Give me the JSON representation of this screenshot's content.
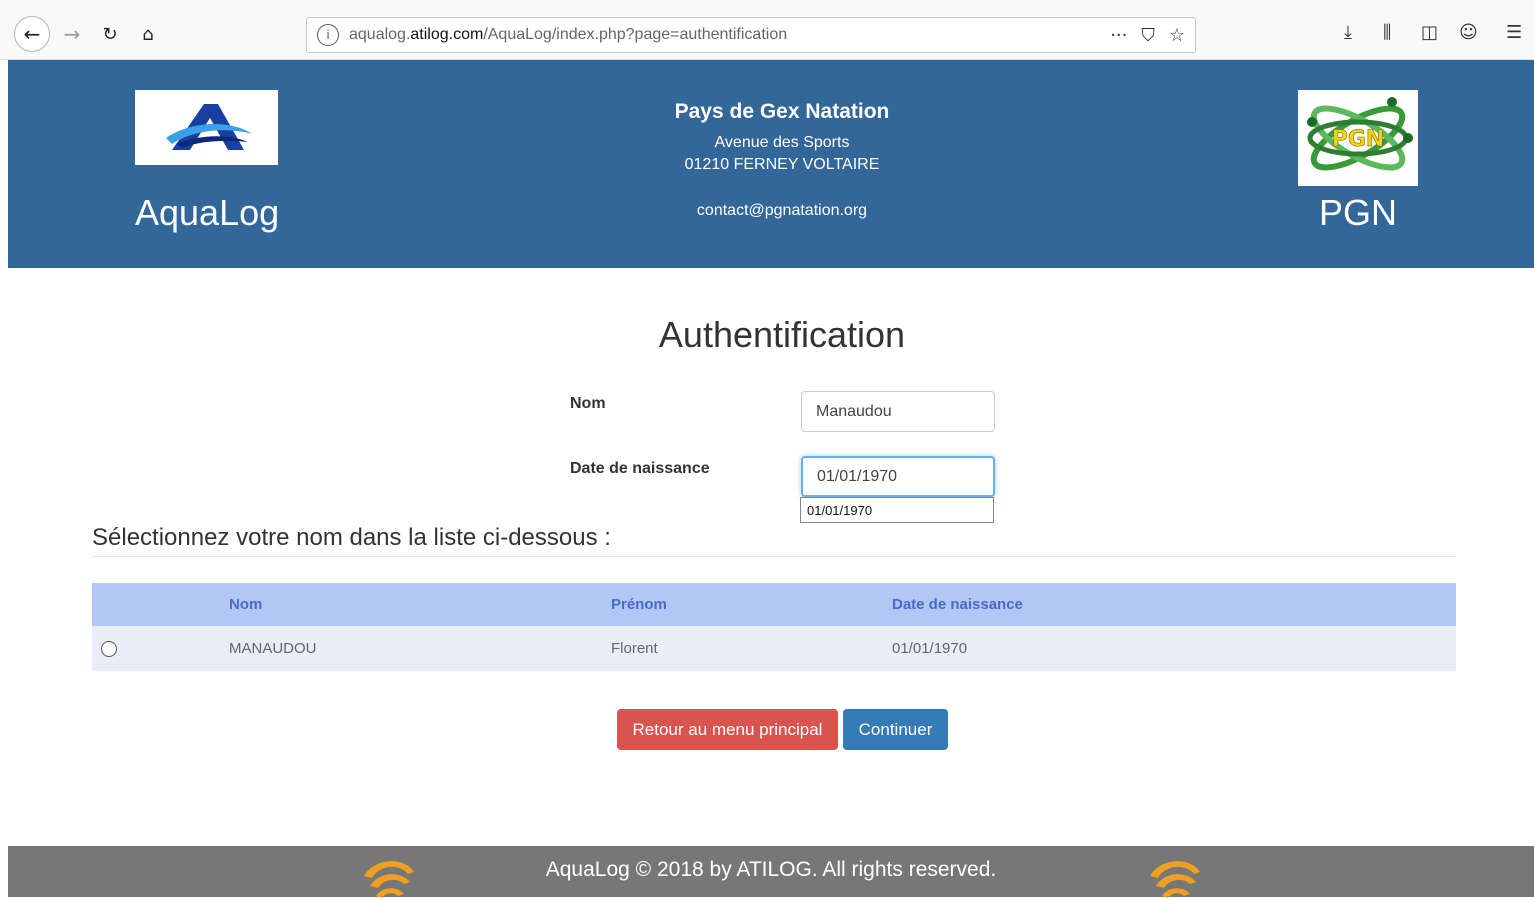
{
  "browser": {
    "url_host": "aqualog.atilog.com",
    "url_pre": "aqualog.",
    "url_domain": "atilog.com",
    "url_path": "/AquaLog/index.php?page=authentification",
    "icons": [
      "back-icon",
      "forward-icon",
      "reload-icon",
      "home-icon",
      "info-icon",
      "more-icon",
      "pocket-icon",
      "bookmark-star-icon",
      "download-icon",
      "library-icon",
      "sidebar-icon",
      "account-icon",
      "menu-icon"
    ]
  },
  "header": {
    "brand_left": "AquaLog",
    "brand_right": "PGN",
    "right_logo_text": "PGN",
    "club_name": "Pays de Gex Natation",
    "address_line1": "Avenue des Sports",
    "address_line2": "01210 FERNEY VOLTAIRE",
    "email": "contact@pgnatation.org",
    "bg_color": "#336699"
  },
  "main": {
    "title": "Authentification",
    "nom_label": "Nom",
    "nom_value": "Manaudou",
    "dob_label": "Date de naissance",
    "dob_value": "01/01/1970",
    "autocomplete_option": "01/01/1970",
    "list_title": "Sélectionnez votre nom dans la liste ci-dessous :"
  },
  "table": {
    "headers": [
      "Nom",
      "Prénom",
      "Date de naissance"
    ],
    "rows": [
      {
        "nom": "MANAUDOU",
        "prenom": "Florent",
        "dob": "01/01/1970",
        "selected": false
      }
    ]
  },
  "buttons": {
    "back": "Retour au menu principal",
    "continue": "Continuer",
    "back_color": "#d9534f",
    "continue_color": "#337ab7"
  },
  "footer": {
    "text": "AquaLog © 2018 by ATILOG. All rights reserved."
  }
}
